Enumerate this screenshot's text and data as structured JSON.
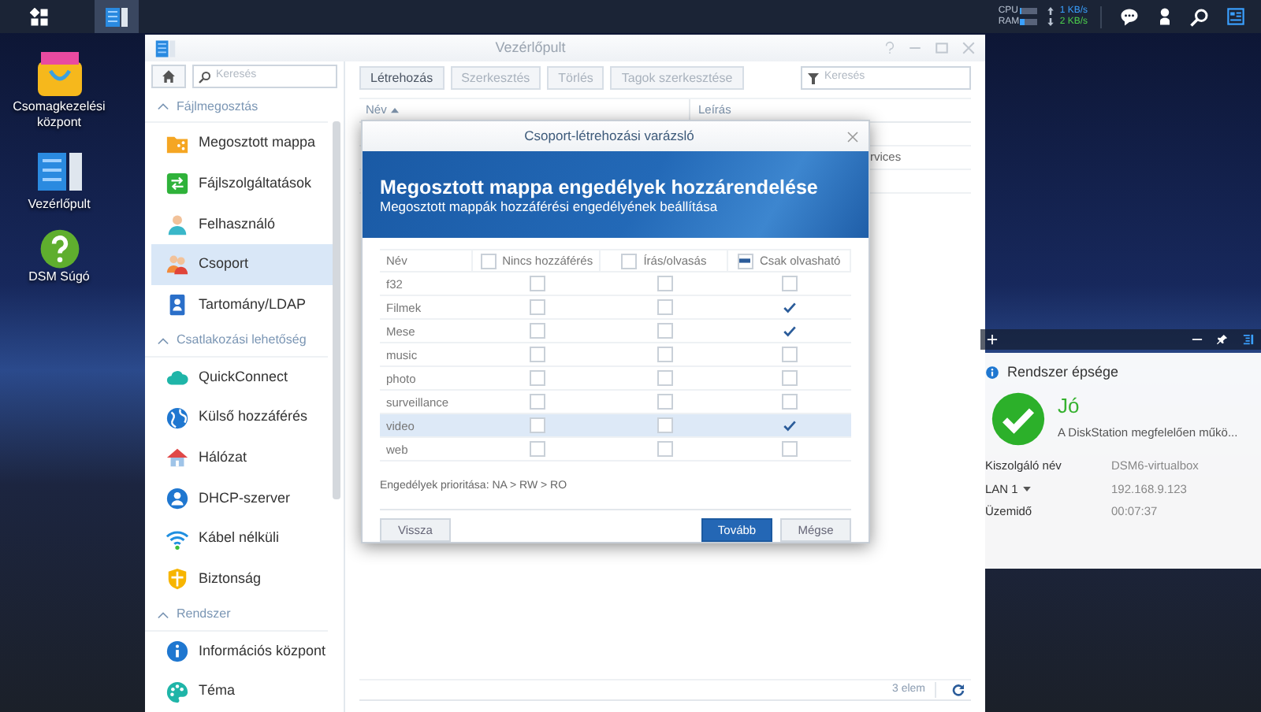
{
  "taskbar": {
    "apps": [
      {
        "kind": "control_panel",
        "selected": true
      }
    ],
    "cpu": {
      "label": "CPU",
      "level": 0.08
    },
    "ram": {
      "label": "RAM",
      "level": 0.22
    },
    "upload": "1 KB/s",
    "download": "2 KB/s"
  },
  "desktop_icons": [
    {
      "label": "Csomagkezelési központ",
      "kind": "package"
    },
    {
      "label": "Vezérlőpult",
      "kind": "control_panel"
    },
    {
      "label": "DSM Súgó",
      "kind": "help"
    }
  ],
  "control_panel": {
    "title": "Vezérlőpult",
    "search_placeholder": "Keresés",
    "sections": [
      {
        "title": "Fájlmegosztás",
        "expanded": true,
        "items": [
          {
            "label": "Megosztott mappa",
            "kind": "shared_folder",
            "selected": false
          },
          {
            "label": "Fájlszolgáltatások",
            "kind": "file_services",
            "selected": false
          },
          {
            "label": "Felhasználó",
            "kind": "user",
            "selected": false
          },
          {
            "label": "Csoport",
            "kind": "group",
            "selected": true
          },
          {
            "label": "Tartomány/LDAP",
            "kind": "domain",
            "selected": false
          }
        ]
      },
      {
        "title": "Csatlakozási lehetőség",
        "expanded": true,
        "items": [
          {
            "label": "QuickConnect",
            "kind": "quickconnect",
            "selected": false
          },
          {
            "label": "Külső hozzáférés",
            "kind": "external_access",
            "selected": false
          },
          {
            "label": "Hálózat",
            "kind": "network",
            "selected": false
          },
          {
            "label": "DHCP-szerver",
            "kind": "dhcp",
            "selected": false
          },
          {
            "label": "Kábel nélküli",
            "kind": "wireless",
            "selected": false
          },
          {
            "label": "Biztonság",
            "kind": "security",
            "selected": false
          }
        ]
      },
      {
        "title": "Rendszer",
        "expanded": true,
        "items": [
          {
            "label": "Információs központ",
            "kind": "info",
            "selected": false
          },
          {
            "label": "Téma",
            "kind": "theme",
            "selected": false
          }
        ]
      }
    ],
    "toolbar": [
      {
        "label": "Létrehozás",
        "disabled": false
      },
      {
        "label": "Szerkesztés",
        "disabled": true
      },
      {
        "label": "Törlés",
        "disabled": true
      },
      {
        "label": "Tagok szerkesztése",
        "disabled": true
      }
    ],
    "filter_placeholder": "Keresés",
    "columns": [
      {
        "label": "Név",
        "sorted_ascending": true
      },
      {
        "label": "Leírás"
      }
    ],
    "rows": [
      {
        "description": "rvices"
      }
    ],
    "footer": "3 elem"
  },
  "dialog": {
    "title": "Csoport-létrehozási varázsló",
    "banner_title": "Megosztott mappa engedélyek hozzárendelése",
    "banner_subtitle": "Megosztott mappák hozzáférési engedélyének beállítása",
    "columns": [
      {
        "label": "Név"
      },
      {
        "label": "Nincs hozzáférés",
        "partial": false
      },
      {
        "label": "Írás/olvasás",
        "partial": false
      },
      {
        "label": "Csak olvasható",
        "partial": true
      }
    ],
    "rows": [
      {
        "name": "f32",
        "no_access": false,
        "read_write": false,
        "read_only": false,
        "selected": false
      },
      {
        "name": "Filmek",
        "no_access": false,
        "read_write": false,
        "read_only": true,
        "selected": false
      },
      {
        "name": "Mese",
        "no_access": false,
        "read_write": false,
        "read_only": true,
        "selected": false
      },
      {
        "name": "music",
        "no_access": false,
        "read_write": false,
        "read_only": false,
        "selected": false
      },
      {
        "name": "photo",
        "no_access": false,
        "read_write": false,
        "read_only": false,
        "selected": false
      },
      {
        "name": "surveillance",
        "no_access": false,
        "read_write": false,
        "read_only": false,
        "selected": false
      },
      {
        "name": "video",
        "no_access": false,
        "read_write": false,
        "read_only": true,
        "selected": true
      },
      {
        "name": "web",
        "no_access": false,
        "read_write": false,
        "read_only": false,
        "selected": false
      }
    ],
    "note": "Engedélyek prioritása: NA > RW > RO",
    "buttons": [
      {
        "label": "Vissza",
        "kind": "back"
      },
      {
        "label": "Tovább",
        "kind": "primary"
      },
      {
        "label": "Mégse",
        "kind": "secondary"
      }
    ]
  },
  "widget": {
    "title": "Rendszer épsége",
    "status": "Jó",
    "message": "A DiskStation megfelelően műkö...",
    "details": [
      {
        "label": "Kiszolgáló név",
        "value": "DSM6-virtualbox",
        "dropdown": false
      },
      {
        "label": "LAN 1",
        "value": "192.168.9.123",
        "dropdown": true
      },
      {
        "label": "Üzemidő",
        "value": "00:07:37",
        "dropdown": false
      }
    ]
  }
}
